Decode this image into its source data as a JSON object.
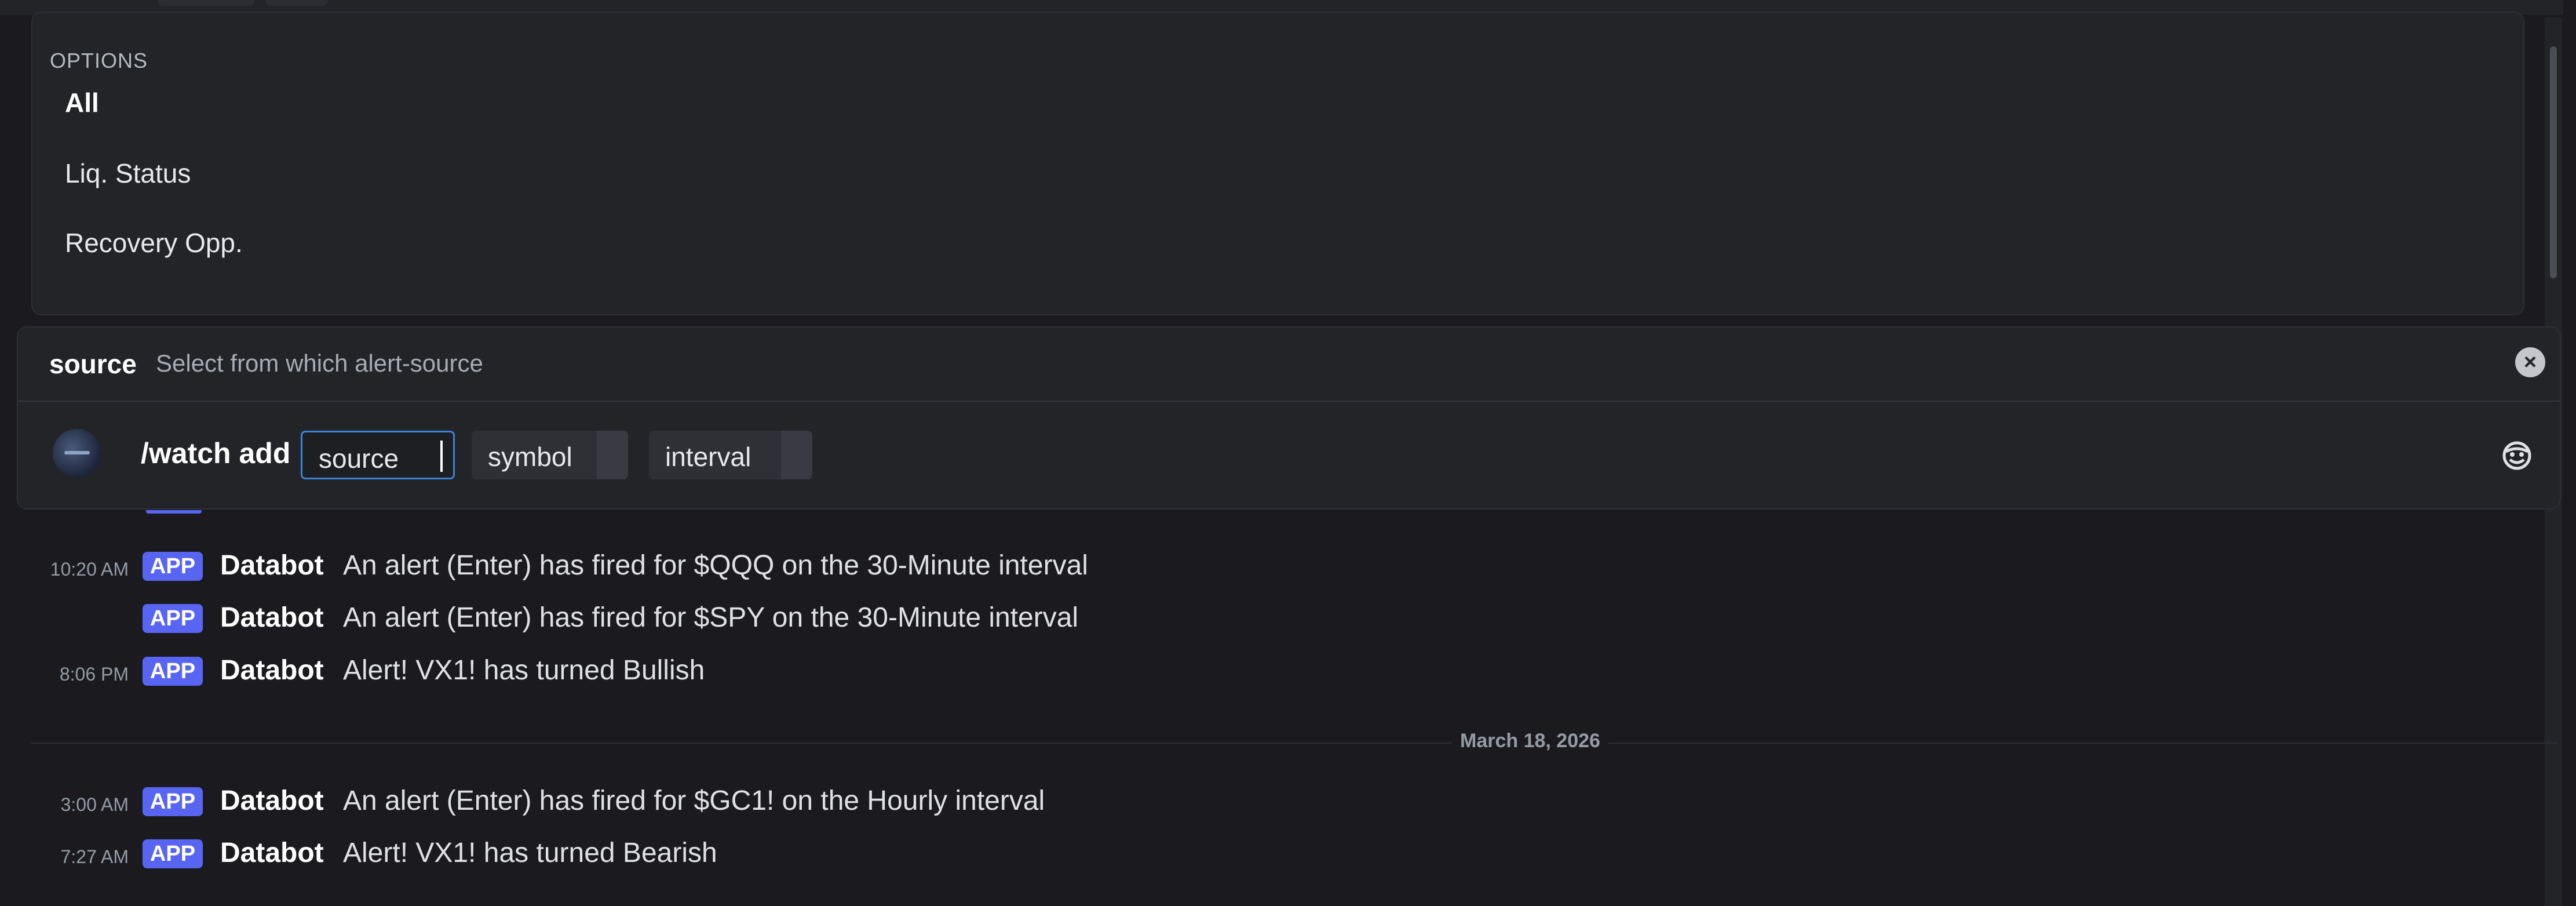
{
  "options_popup": {
    "header": "OPTIONS",
    "items": [
      {
        "label": "All",
        "selected": true
      },
      {
        "label": "Liq. Status",
        "selected": false
      },
      {
        "label": "Recovery Opp.",
        "selected": false
      }
    ]
  },
  "command": {
    "param_name": "source",
    "param_description": "Select from which alert-source",
    "command_text": "/watch add",
    "args": [
      "source",
      "symbol",
      "interval"
    ],
    "active_arg": "source"
  },
  "messages": [
    {
      "time": "10:20 AM",
      "badge": "APP",
      "author": "Databot",
      "text": "An alert (Enter) has fired for $QQQ on the 30-Minute interval"
    },
    {
      "time": "",
      "badge": "APP",
      "author": "Databot",
      "text": "An alert (Enter) has fired for $SPY on the 30-Minute interval"
    },
    {
      "time": "8:06 PM",
      "badge": "APP",
      "author": "Databot",
      "text": "Alert! VX1! has turned Bullish"
    },
    {
      "time": "3:00 AM",
      "badge": "APP",
      "author": "Databot",
      "text": "An alert (Enter) has fired for $GC1! on the Hourly interval"
    },
    {
      "time": "7:27 AM",
      "badge": "APP",
      "author": "Databot",
      "text": "Alert! VX1! has turned Bearish"
    }
  ],
  "date_divider": "March 18, 2026",
  "icons": {
    "clear": "clear-circle-icon",
    "emoji": "emoji-picker-icon",
    "avatar": "bot-avatar"
  },
  "colors": {
    "background": "#1b1b1f",
    "panel": "#232428",
    "app_badge": "#5865f2",
    "focus_border": "#3b82d6"
  }
}
